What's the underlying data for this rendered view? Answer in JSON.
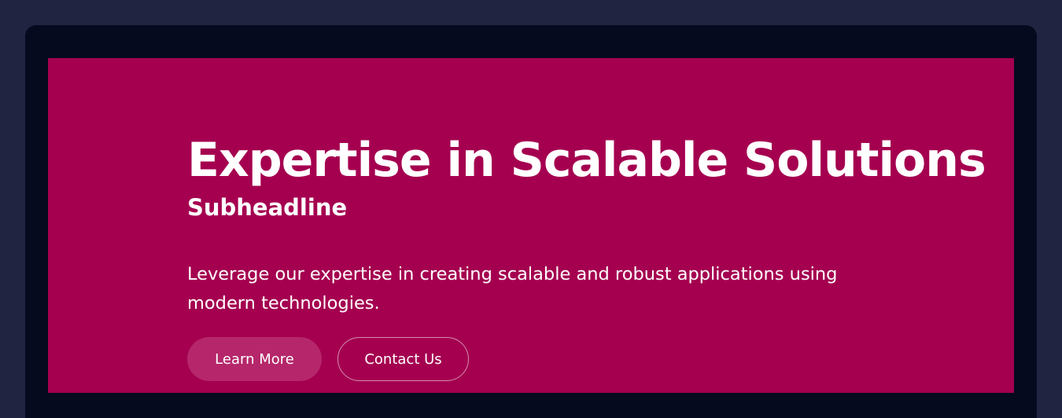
{
  "hero": {
    "title": "Expertise in Scalable Solutions",
    "subtitle": "Subheadline",
    "description": "Leverage our expertise in creating scalable and robust applications using modern technologies.",
    "primary_button": "Learn More",
    "secondary_button": "Contact Us"
  },
  "colors": {
    "page_background": "#212440",
    "frame": "#050a1f",
    "hero_background": "#a50050",
    "primary_button": "#b5276a",
    "text": "#ffffff"
  }
}
